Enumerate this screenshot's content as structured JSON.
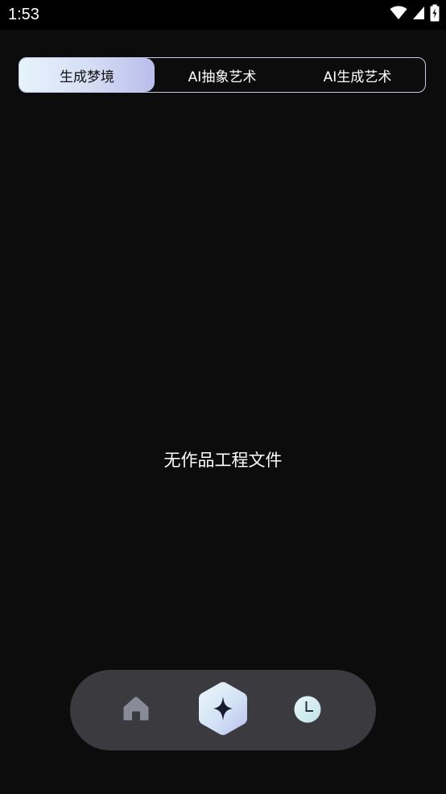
{
  "status_bar": {
    "time": "1:53",
    "icons": [
      "wifi-icon",
      "cellular-signal-icon",
      "battery-charging-icon"
    ]
  },
  "tabs": [
    {
      "label": "生成梦境",
      "active": true
    },
    {
      "label": "AI抽象艺术",
      "active": false
    },
    {
      "label": "AI生成艺术",
      "active": false
    }
  ],
  "main": {
    "empty_message": "无作品工程文件"
  },
  "bottom_nav": {
    "items": [
      {
        "icon": "home-icon",
        "active": false
      },
      {
        "icon": "sparkle-icon",
        "active": true
      },
      {
        "icon": "clock-icon",
        "active": false
      }
    ]
  },
  "colors": {
    "background": "#0c0c0d",
    "tab_border": "#c9cbe6",
    "tab_active_gradient_start": "#e6f4fb",
    "tab_active_gradient_end": "#b9bdea",
    "nav_background": "#3a3a3f"
  }
}
